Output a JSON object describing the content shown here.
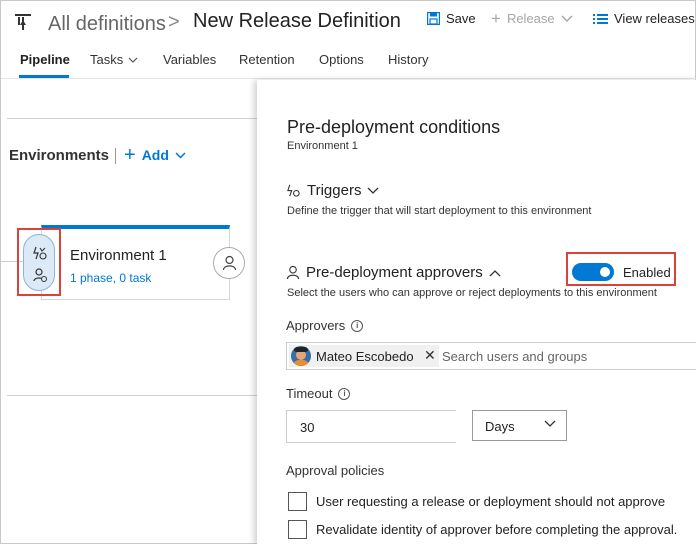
{
  "header": {
    "breadcrumb": "All definitions",
    "breadcrumb_separator": ">",
    "title": "New Release Definition",
    "save_label": "Save",
    "release_label": "Release",
    "view_releases_label": "View releases"
  },
  "tabs": [
    {
      "label": "Pipeline",
      "active": true
    },
    {
      "label": "Tasks",
      "active": false
    },
    {
      "label": "Variables",
      "active": false
    },
    {
      "label": "Retention",
      "active": false
    },
    {
      "label": "Options",
      "active": false
    },
    {
      "label": "History",
      "active": false
    }
  ],
  "canvas": {
    "environments_label": "Environments",
    "add_label": "Add",
    "environment": {
      "name": "Environment 1",
      "summary": "1 phase, 0 task"
    }
  },
  "panel": {
    "title": "Pre-deployment conditions",
    "subtitle": "Environment 1",
    "triggers": {
      "label": "Triggers",
      "description": "Define the trigger that will start deployment to this environment"
    },
    "approvers_section": {
      "label": "Pre-deployment approvers",
      "description": "Select the users who can approve or reject deployments to this environment",
      "toggle_label": "Enabled",
      "toggle_on": true
    },
    "approvers_field": {
      "label": "Approvers",
      "chip_name": "Mateo Escobedo",
      "search_placeholder": "Search users and groups"
    },
    "timeout": {
      "label": "Timeout",
      "value": "30",
      "unit": "Days"
    },
    "policies": {
      "label": "Approval policies",
      "items": [
        {
          "label": "User requesting a release or deployment should not approve",
          "checked": false
        },
        {
          "label": "Revalidate identity of approver before completing the approval.",
          "checked": false
        }
      ]
    }
  },
  "colors": {
    "accent": "#0078d4",
    "highlight": "#d9433a"
  }
}
